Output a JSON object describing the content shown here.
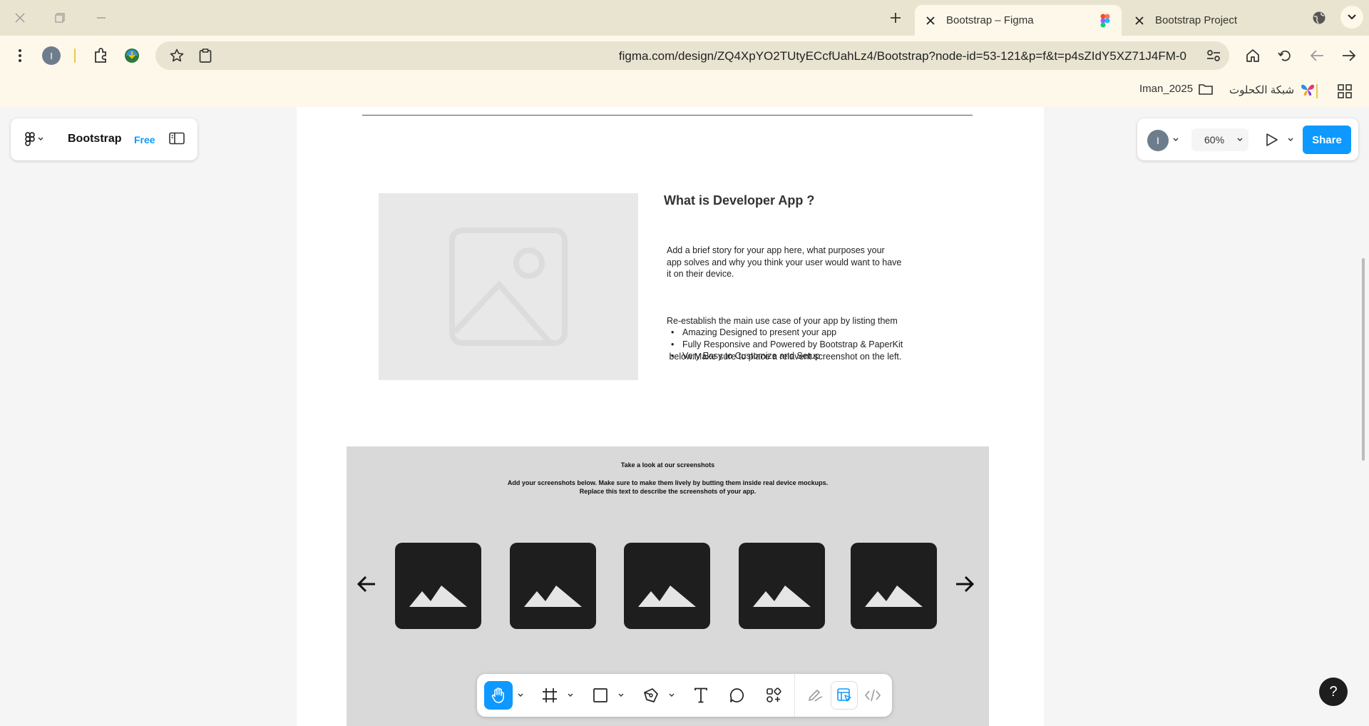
{
  "browser": {
    "tabs": [
      {
        "title": "Bootstrap – Figma",
        "active": true
      },
      {
        "title": "Bootstrap Project",
        "active": false
      }
    ],
    "profile_initial": "I",
    "url": "figma.com/design/ZQ4XpYO2TUtyECcfUahLz4/Bootstrap?node-id=53-121&p=f&t=p4sZIdY5XZ71J4FM-0",
    "bookmarks": [
      {
        "label": "Iman_2025",
        "icon": "folder-icon"
      },
      {
        "label": "شبكة الكحلوت",
        "icon": "butterfly-icon"
      }
    ]
  },
  "figma": {
    "file_name": "Bootstrap",
    "plan": "Free",
    "user_initial": "I",
    "zoom": "60%",
    "share_label": "Share",
    "help_label": "?",
    "tools": [
      "hand-tool",
      "frame-tool",
      "rectangle-tool",
      "pen-tool",
      "text-tool",
      "comment-tool",
      "actions-tool",
      "draw-mode",
      "design-mode",
      "dev-mode"
    ],
    "active_tool": "hand-tool"
  },
  "content": {
    "about": {
      "title": "What is Developer App ?",
      "paragraph1_line1": "Add a brief story for your app here, what purposes your",
      "paragraph1_line2": "app solves and why you think your user would want to have",
      "paragraph1_line3": "it on their device.",
      "paragraph2_line1": "Re-establish the main use case of your app by listing them",
      "paragraph2_line2": " below.Make sure to place a relavent screenshot on the left.",
      "bullets": [
        "Amazing Designed to present your app",
        "Fully Responsive and Powered by Bootstrap & PaperKit",
        "Very Easy to Customize and Setup"
      ]
    },
    "screenshots": {
      "title": "Take a look at our screenshots",
      "desc_line1": "Add your screenshots below. Make sure to make them lively by butting them inside real device mockups.",
      "desc_line2": "Replace this text to describe the screenshots of your app.",
      "count": 5
    }
  },
  "colors": {
    "figma_blue": "#0d99ff",
    "chrome_tabbar": "#e9e4cf",
    "chrome_toolbar": "#fdf8ea",
    "thumb_bg": "#1e1e1e",
    "section_bg": "#d9d9d9"
  }
}
